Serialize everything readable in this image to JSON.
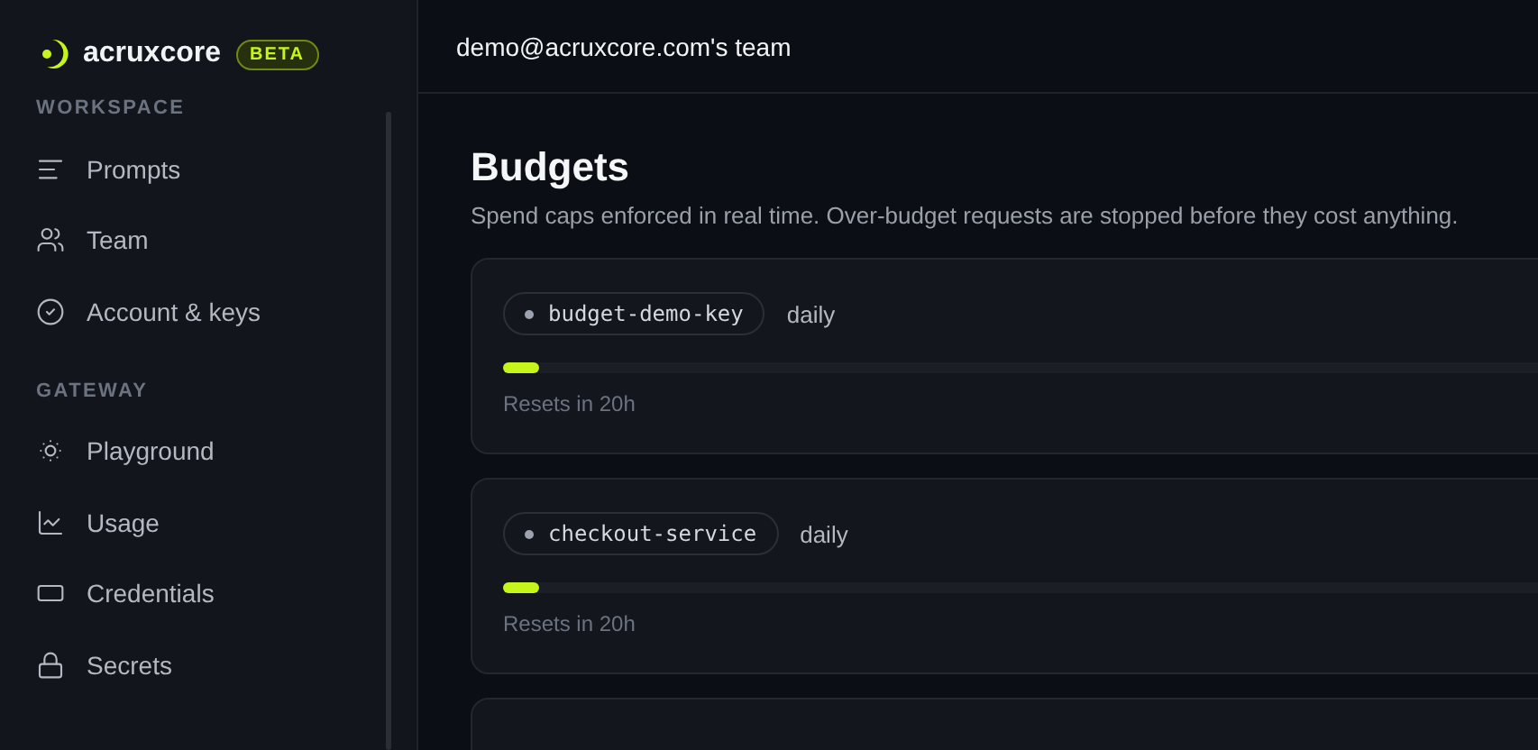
{
  "brand": {
    "name": "acruxcore",
    "badge": "BETA"
  },
  "sidebar": {
    "sections": [
      {
        "title": "WORKSPACE",
        "items": [
          {
            "label": "Prompts",
            "kind": "lines",
            "selected": false
          },
          {
            "label": "Team",
            "kind": "users",
            "selected": false
          },
          {
            "label": "Account & keys",
            "kind": "check",
            "selected": false
          }
        ]
      },
      {
        "title": "GATEWAY",
        "items": [
          {
            "label": "Playground",
            "kind": "sun",
            "selected": false
          },
          {
            "label": "Usage",
            "kind": "chart",
            "selected": false
          },
          {
            "label": "Credentials",
            "kind": "card",
            "selected": false
          },
          {
            "label": "Secrets",
            "kind": "lock",
            "selected": false
          }
        ]
      }
    ]
  },
  "header": {
    "team": "demo@acruxcore.com's team"
  },
  "page": {
    "title": "Budgets",
    "subtitle": "Spend caps enforced in real time. Over-budget requests are stopped before they cost anything."
  },
  "budgets": [
    {
      "key": "budget-demo-key",
      "period": "daily",
      "level": 0.03,
      "reset": "Resets in 20h"
    },
    {
      "key": "checkout-service",
      "period": "daily",
      "level": 0.03,
      "reset": "Resets in 20h"
    }
  ]
}
